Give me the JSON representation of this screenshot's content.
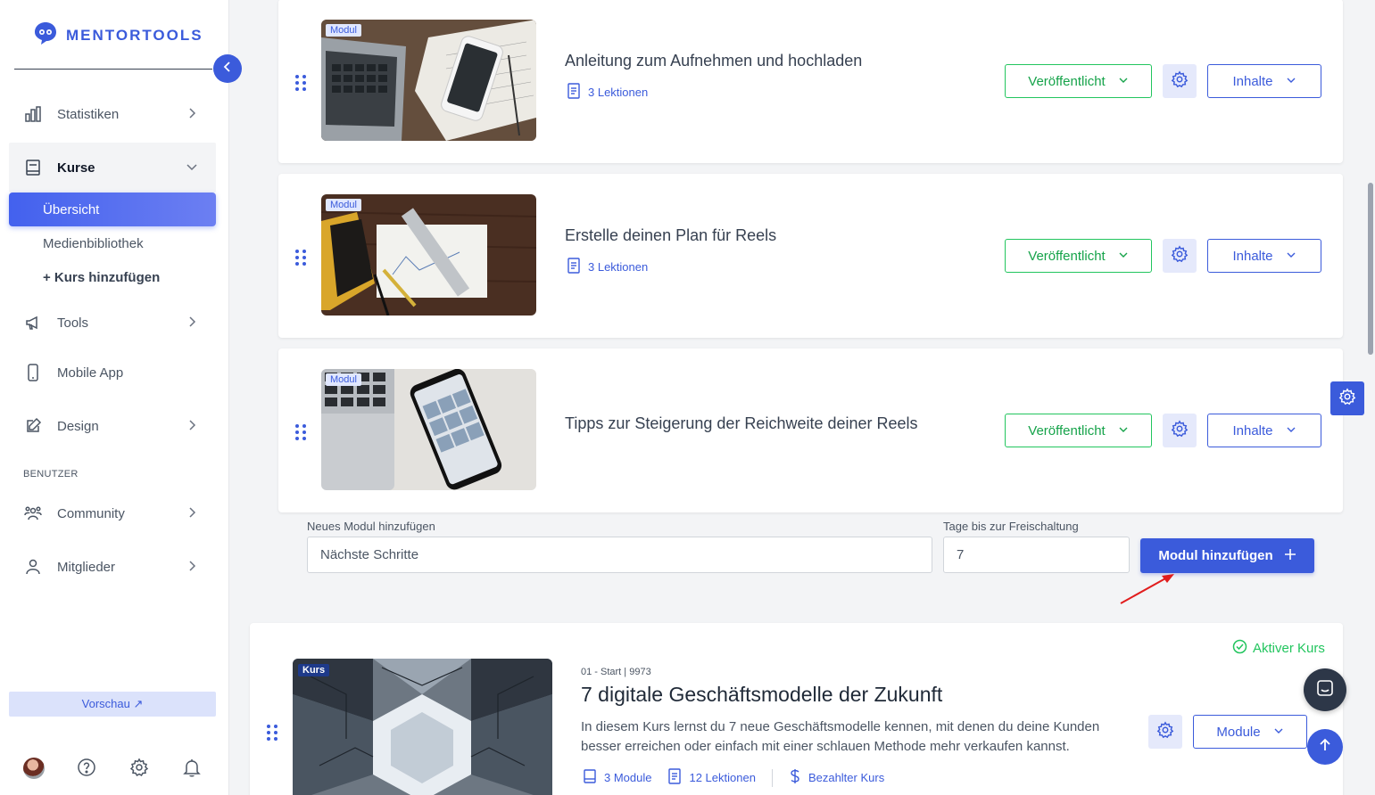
{
  "brand": {
    "name": "MENTORTOOLS",
    "color": "#3b5bdb"
  },
  "sidebar": {
    "items": [
      {
        "label": "Statistiken",
        "icon": "bar-chart-icon"
      },
      {
        "label": "Kurse",
        "icon": "book-icon"
      },
      {
        "label": "Tools",
        "icon": "megaphone-icon"
      },
      {
        "label": "Mobile App",
        "icon": "smartphone-icon"
      },
      {
        "label": "Design",
        "icon": "edit-icon"
      },
      {
        "label": "Community",
        "icon": "users-icon"
      },
      {
        "label": "Mitglieder",
        "icon": "user-icon"
      }
    ],
    "kurse_sub": [
      {
        "label": "Übersicht"
      },
      {
        "label": "Medienbibliothek"
      },
      {
        "label": "+ Kurs hinzufügen"
      }
    ],
    "section_benutzer": "BENUTZER",
    "preview_label": "Vorschau ↗"
  },
  "modules": [
    {
      "badge": "Modul",
      "title": "Anleitung zum Aufnehmen und hochladen",
      "lessons": "3 Lektionen",
      "status": "Veröffentlicht",
      "content_label": "Inhalte"
    },
    {
      "badge": "Modul",
      "title": "Erstelle deinen Plan für Reels",
      "lessons": "3 Lektionen",
      "status": "Veröffentlicht",
      "content_label": "Inhalte"
    },
    {
      "badge": "Modul",
      "title": "Tipps zur Steigerung der Reichweite deiner Reels",
      "lessons": "",
      "status": "Veröffentlicht",
      "content_label": "Inhalte"
    }
  ],
  "add_module_form": {
    "name_label": "Neues Modul hinzufügen",
    "name_value": "Nächste Schritte",
    "days_label": "Tage bis zur Freischaltung",
    "days_value": "7",
    "submit_label": "Modul hinzufügen"
  },
  "course": {
    "badge": "Kurs",
    "status": "Aktiver Kurs",
    "meta": "01 - Start | 9973",
    "title": "7 digitale Geschäftsmodelle der Zukunft",
    "description": "In diesem Kurs lernst du 7 neue Geschäftsmodelle kennen, mit denen du deine Kunden besser erreichen oder einfach mit einer schlauen Methode mehr verkaufen kannst.",
    "modules_count": "3 Module",
    "lessons_count": "12 Lektionen",
    "pricing": "Bezahlter Kurs",
    "modules_button": "Module"
  },
  "colors": {
    "accent": "#3b5bdb",
    "published": "#16a34a",
    "active": "#22c55e"
  }
}
